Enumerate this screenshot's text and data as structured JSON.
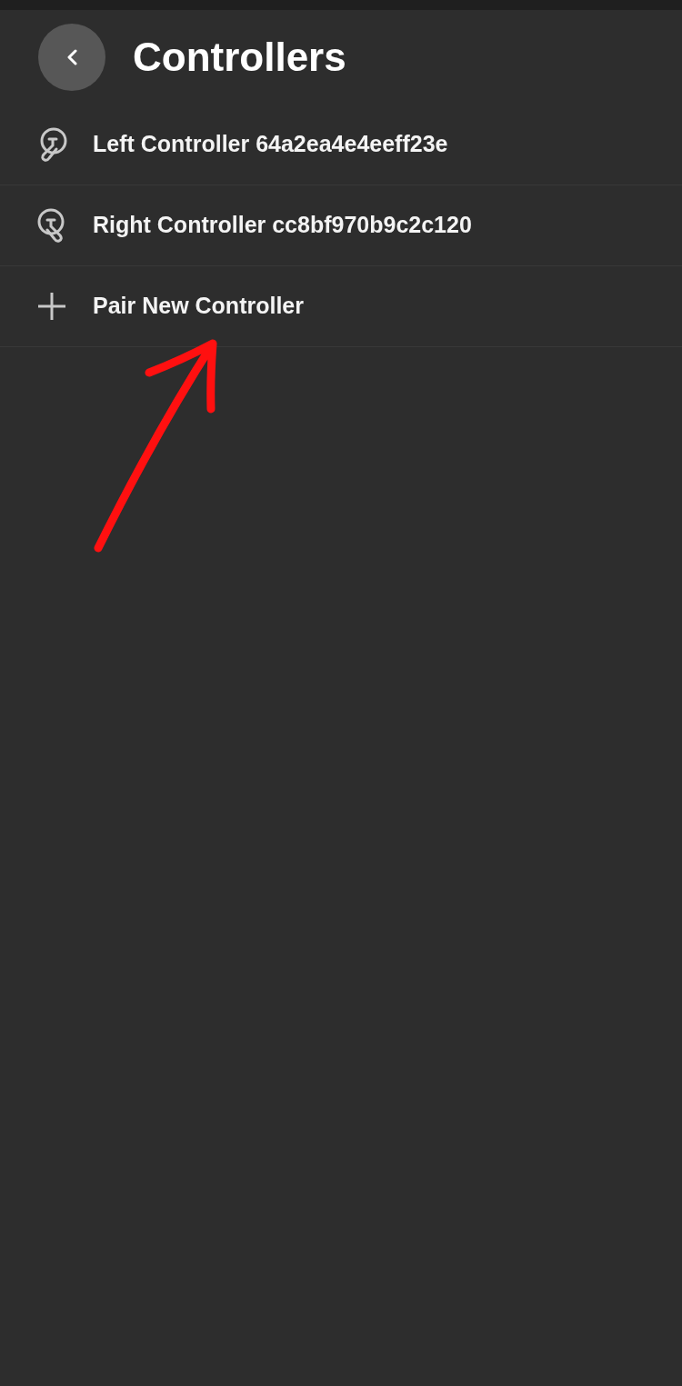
{
  "header": {
    "title": "Controllers"
  },
  "items": [
    {
      "kind": "left",
      "label": "Left Controller 64a2ea4e4eeff23e"
    },
    {
      "kind": "right",
      "label": "Right Controller cc8bf970b9c2c120"
    },
    {
      "kind": "add",
      "label": "Pair New Controller"
    }
  ]
}
